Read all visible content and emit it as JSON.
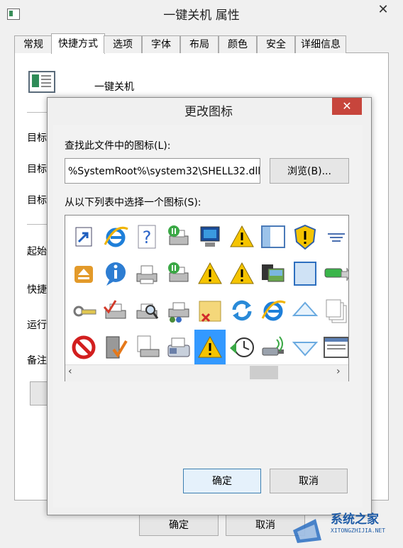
{
  "outer_window": {
    "title": "一键关机 属性",
    "close_glyph": "✕",
    "tabs": [
      "常规",
      "快捷方式",
      "选项",
      "字体",
      "布局",
      "颜色",
      "安全",
      "详细信息"
    ],
    "active_tab": "快捷方式",
    "app_name": "一键关机",
    "side_labels": [
      "目标",
      "目标",
      "目标",
      "起始",
      "快捷",
      "运行",
      "备注"
    ],
    "ok_label": "确定",
    "cancel_label": "取消"
  },
  "dialog": {
    "title": "更改图标",
    "close_glyph": "✕",
    "find_label": "查找此文件中的图标(L):",
    "path_value": "%SystemRoot%\\system32\\SHELL32.dll",
    "browse_label": "浏览(B)...",
    "select_label": "从以下列表中选择一个图标(S):",
    "icons": [
      [
        "shortcut-arrow-icon",
        "ie-icon",
        "help-icon",
        "printer-paused-icon",
        "computer-icon",
        "warning-icon",
        "window-panel-icon",
        "shield-warning-icon",
        "align-lines-icon"
      ],
      [
        "eject-icon",
        "info-icon",
        "printer-icon",
        "printer-paused-icon",
        "warning-icon",
        "warning-icon",
        "film-photo-icon",
        "blank-square-icon",
        "battery-arrow-icon"
      ],
      [
        "network-cable-icon",
        "printer-check-icon",
        "printer-search-icon",
        "printer-network-icon",
        "folder-delete-icon",
        "refresh-icon",
        "ie-icon",
        "triangle-up-icon",
        "stacked-pages-icon"
      ],
      [
        "prohibited-icon",
        "server-check-icon",
        "document-printer-icon",
        "fax-icon",
        "warning-icon",
        "clock-back-icon",
        "usb-wireless-icon",
        "triangle-down-icon",
        "window-layout-icon"
      ]
    ],
    "selected_icon": [
      3,
      4
    ],
    "scroll_left_glyph": "‹",
    "scroll_right_glyph": "›",
    "ok_label": "确定",
    "cancel_label": "取消"
  },
  "watermark": {
    "main": "系统之家",
    "sub": "XITONGZHIJIA.NET"
  }
}
